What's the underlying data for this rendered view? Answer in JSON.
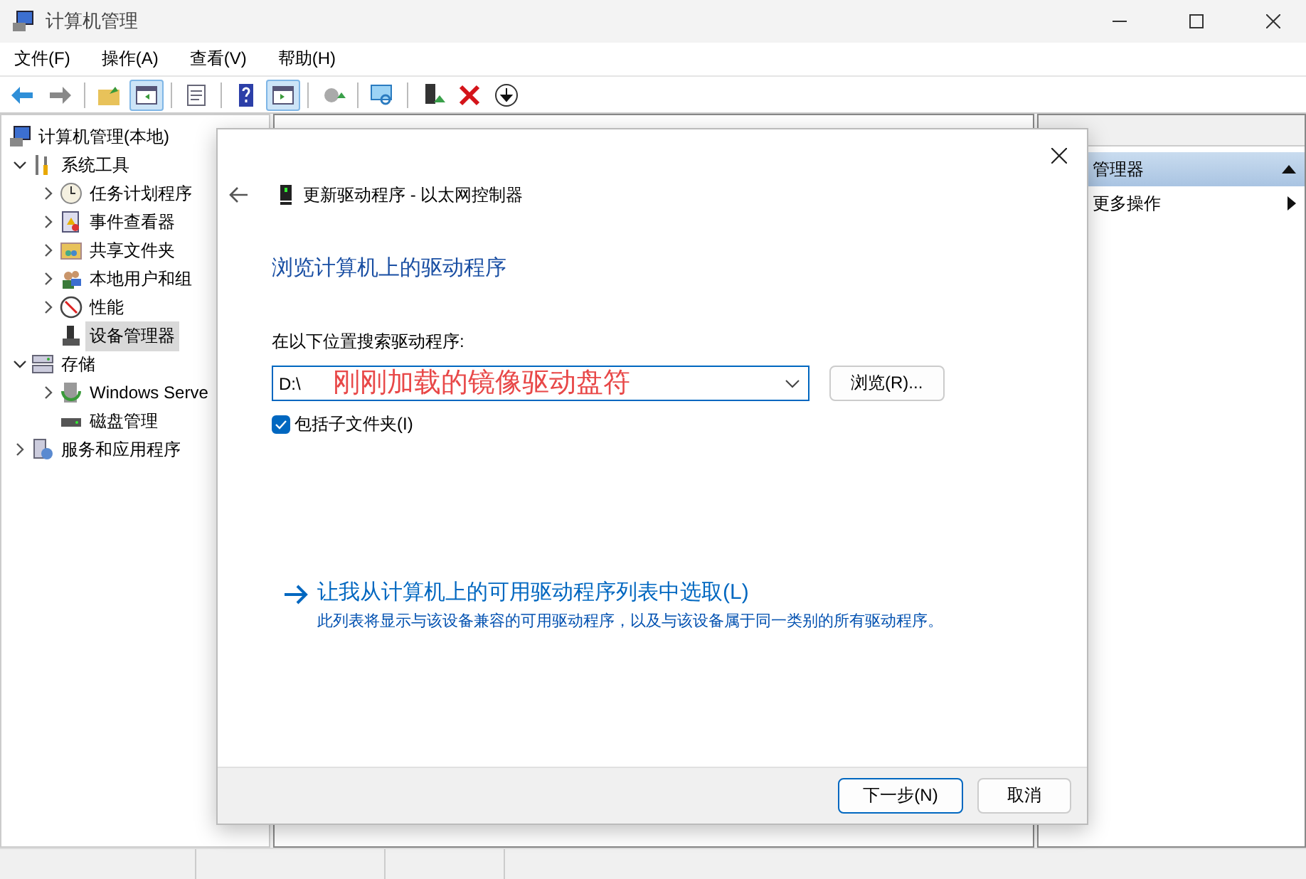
{
  "window": {
    "title": "计算机管理"
  },
  "menu": [
    "文件(F)",
    "操作(A)",
    "查看(V)",
    "帮助(H)"
  ],
  "toolbar": [
    {
      "kind": "back",
      "pressed": false
    },
    {
      "kind": "forward",
      "pressed": false
    },
    {
      "kind": "sep"
    },
    {
      "kind": "up",
      "pressed": false
    },
    {
      "kind": "tree",
      "pressed": true
    },
    {
      "kind": "sep"
    },
    {
      "kind": "props",
      "pressed": false
    },
    {
      "kind": "sep"
    },
    {
      "kind": "help",
      "pressed": false
    },
    {
      "kind": "pane",
      "pressed": true
    },
    {
      "kind": "sep"
    },
    {
      "kind": "update",
      "pressed": false
    },
    {
      "kind": "sep"
    },
    {
      "kind": "scan",
      "pressed": false
    },
    {
      "kind": "sep"
    },
    {
      "kind": "enable",
      "pressed": false
    },
    {
      "kind": "remove",
      "pressed": false
    },
    {
      "kind": "down",
      "pressed": false
    }
  ],
  "tree": [
    {
      "label": "计算机管理(本地)",
      "kind": "computer",
      "selected": false,
      "children": [
        {
          "label": "系统工具",
          "kind": "tools",
          "expanded": true,
          "selected": false,
          "children": [
            {
              "label": "任务计划程序",
              "kind": "clock",
              "expanded": false,
              "selected": false
            },
            {
              "label": "事件查看器",
              "kind": "log",
              "expanded": false,
              "selected": false
            },
            {
              "label": "共享文件夹",
              "kind": "share",
              "expanded": false,
              "selected": false
            },
            {
              "label": "本地用户和组",
              "kind": "users",
              "expanded": false,
              "selected": false
            },
            {
              "label": "性能",
              "kind": "perf",
              "expanded": false,
              "selected": false
            },
            {
              "label": "设备管理器",
              "kind": "device",
              "selected": true
            }
          ]
        },
        {
          "label": "存储",
          "kind": "storage",
          "expanded": true,
          "selected": false,
          "children": [
            {
              "label": "Windows Serve",
              "kind": "backup",
              "expanded": false,
              "selected": false
            },
            {
              "label": "磁盘管理",
              "kind": "disk",
              "selected": false
            }
          ]
        },
        {
          "label": "服务和应用程序",
          "kind": "services",
          "expanded": false,
          "selected": false
        }
      ]
    }
  ],
  "actions_pane": [
    {
      "label": "管理器",
      "kind": "header"
    },
    {
      "label": "更多操作",
      "kind": "submenu"
    }
  ],
  "dialog": {
    "title": "更新驱动程序 - 以太网控制器",
    "heading": "浏览计算机上的驱动程序",
    "search_label": "在以下位置搜索驱动程序:",
    "path": {
      "value": "D:\\"
    },
    "browse_button": "浏览(R)...",
    "include_subfolders": {
      "label": "包括子文件夹(I)",
      "checked": true
    },
    "pick_link": {
      "label": "让我从计算机上的可用驱动程序列表中选取(L)",
      "description": "此列表将显示与该设备兼容的可用驱动程序，以及与该设备属于同一类别的所有驱动程序。"
    },
    "buttons": [
      {
        "label": "下一步(N)",
        "default": true
      },
      {
        "label": "取消",
        "default": false
      }
    ]
  },
  "annotation": "刚刚加载的镜像驱动盘符"
}
